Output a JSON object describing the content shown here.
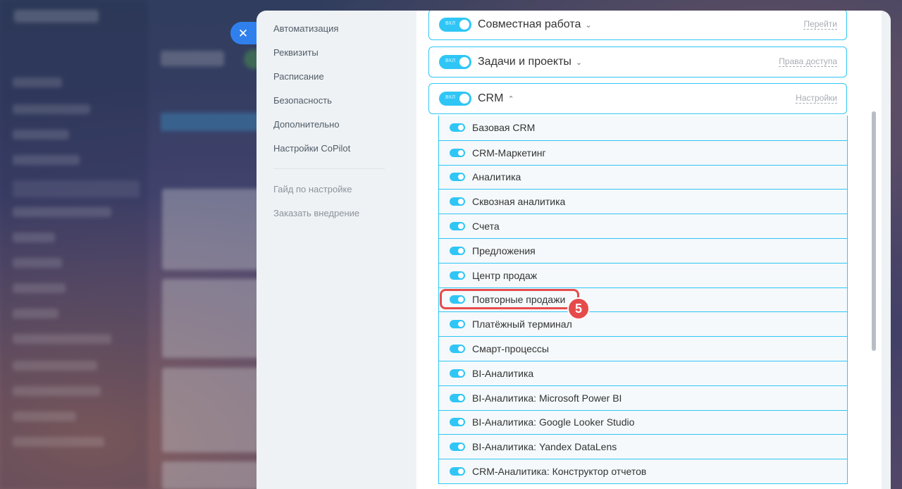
{
  "settings_menu": {
    "items": [
      {
        "label": "Автоматизация"
      },
      {
        "label": "Реквизиты"
      },
      {
        "label": "Расписание"
      },
      {
        "label": "Безопасность"
      },
      {
        "label": "Дополнительно"
      },
      {
        "label": "Настройки CoPilot"
      }
    ],
    "secondary_items": [
      {
        "label": "Гайд по настройке"
      },
      {
        "label": "Заказать внедрение"
      }
    ]
  },
  "close_button": {
    "icon": "close-icon",
    "glyph": "✕"
  },
  "sections": [
    {
      "title": "Совместная работа",
      "toggle_label": "ВКЛ",
      "toggle_on": true,
      "expanded": false,
      "link": "Перейти"
    },
    {
      "title": "Задачи и проекты",
      "toggle_label": "ВКЛ",
      "toggle_on": true,
      "expanded": false,
      "link": "Права доступа"
    },
    {
      "title": "CRM",
      "toggle_label": "ВКЛ",
      "toggle_on": true,
      "expanded": true,
      "link": "Настройки"
    }
  ],
  "crm_modules": [
    {
      "label": "Базовая CRM",
      "on": true
    },
    {
      "label": "CRM-Маркетинг",
      "on": true
    },
    {
      "label": "Аналитика",
      "on": true
    },
    {
      "label": "Сквозная аналитика",
      "on": true
    },
    {
      "label": "Счета",
      "on": true
    },
    {
      "label": "Предложения",
      "on": true
    },
    {
      "label": "Центр продаж",
      "on": true
    },
    {
      "label": "Повторные продажи",
      "on": true
    },
    {
      "label": "Платёжный терминал",
      "on": true
    },
    {
      "label": "Смарт-процессы",
      "on": true
    },
    {
      "label": "BI-Аналитика",
      "on": true
    },
    {
      "label": "BI-Аналитика: Microsoft Power BI",
      "on": true
    },
    {
      "label": "BI-Аналитика: Google Looker Studio",
      "on": true
    },
    {
      "label": "BI-Аналитика: Yandex DataLens",
      "on": true
    },
    {
      "label": "CRM-Аналитика: Конструктор отчетов",
      "on": true
    }
  ],
  "annotation": {
    "step": "5",
    "target": "Повторные продажи",
    "color": "#e64b4b"
  },
  "colors": {
    "accent": "#2fc6f6",
    "close_button": "#2f80ed",
    "highlight": "#e64b4b"
  }
}
